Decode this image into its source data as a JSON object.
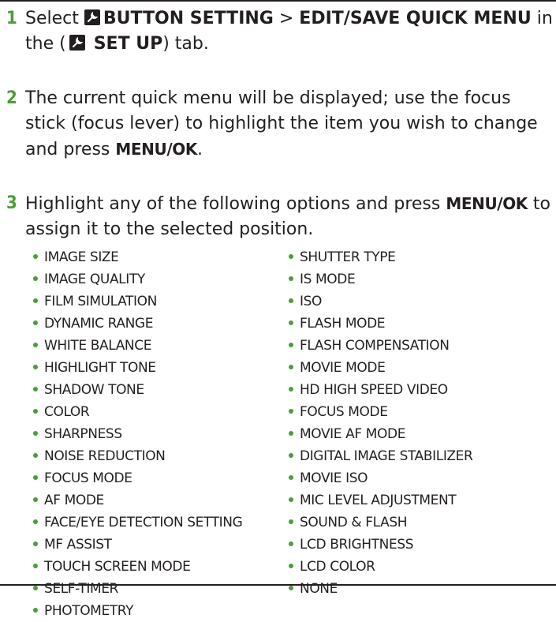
{
  "steps": [
    {
      "number": "1",
      "parts": {
        "select": "Select",
        "button_setting": "BUTTON SETTING",
        "separator": ">",
        "edit_save": "EDIT/SAVE QUICK MENU",
        "in_the": "in the",
        "open_paren": "(",
        "set_up": "SET UP",
        "close_tab": ") tab."
      }
    },
    {
      "number": "2",
      "text_before": "The current quick menu will be displayed; use the focus stick (focus lever) to highlight the item you wish to change and press",
      "button": "MENU/OK",
      "text_after": "."
    },
    {
      "number": "3",
      "text_before": "Highlight any of the following options and press",
      "button": "MENU/OK",
      "text_after": "to assign it to the selected position."
    }
  ],
  "options_left": [
    "IMAGE SIZE",
    "IMAGE QUALITY",
    "FILM SIMULATION",
    "DYNAMIC RANGE",
    "WHITE BALANCE",
    "HIGHLIGHT TONE",
    "SHADOW TONE",
    "COLOR",
    "SHARPNESS",
    "NOISE REDUCTION",
    "FOCUS MODE",
    "AF MODE",
    "FACE/EYE DETECTION SETTING",
    "MF ASSIST",
    "TOUCH SCREEN MODE",
    "SELF-TIMER",
    "PHOTOMETRY"
  ],
  "options_right": [
    "SHUTTER TYPE",
    "IS MODE",
    "ISO",
    "FLASH MODE",
    "FLASH COMPENSATION",
    "MOVIE MODE",
    "HD HIGH SPEED VIDEO",
    "FOCUS MODE",
    "MOVIE AF MODE",
    "DIGITAL IMAGE STABILIZER",
    "MOVIE ISO",
    "MIC LEVEL ADJUSTMENT",
    "SOUND & FLASH",
    "LCD BRIGHTNESS",
    "LCD COLOR",
    "NONE"
  ],
  "colors": {
    "accent": "#4a9d3a",
    "text": "#231f20"
  },
  "icons": {
    "setup": "wrench-icon",
    "bullet": "bullet-dot"
  }
}
